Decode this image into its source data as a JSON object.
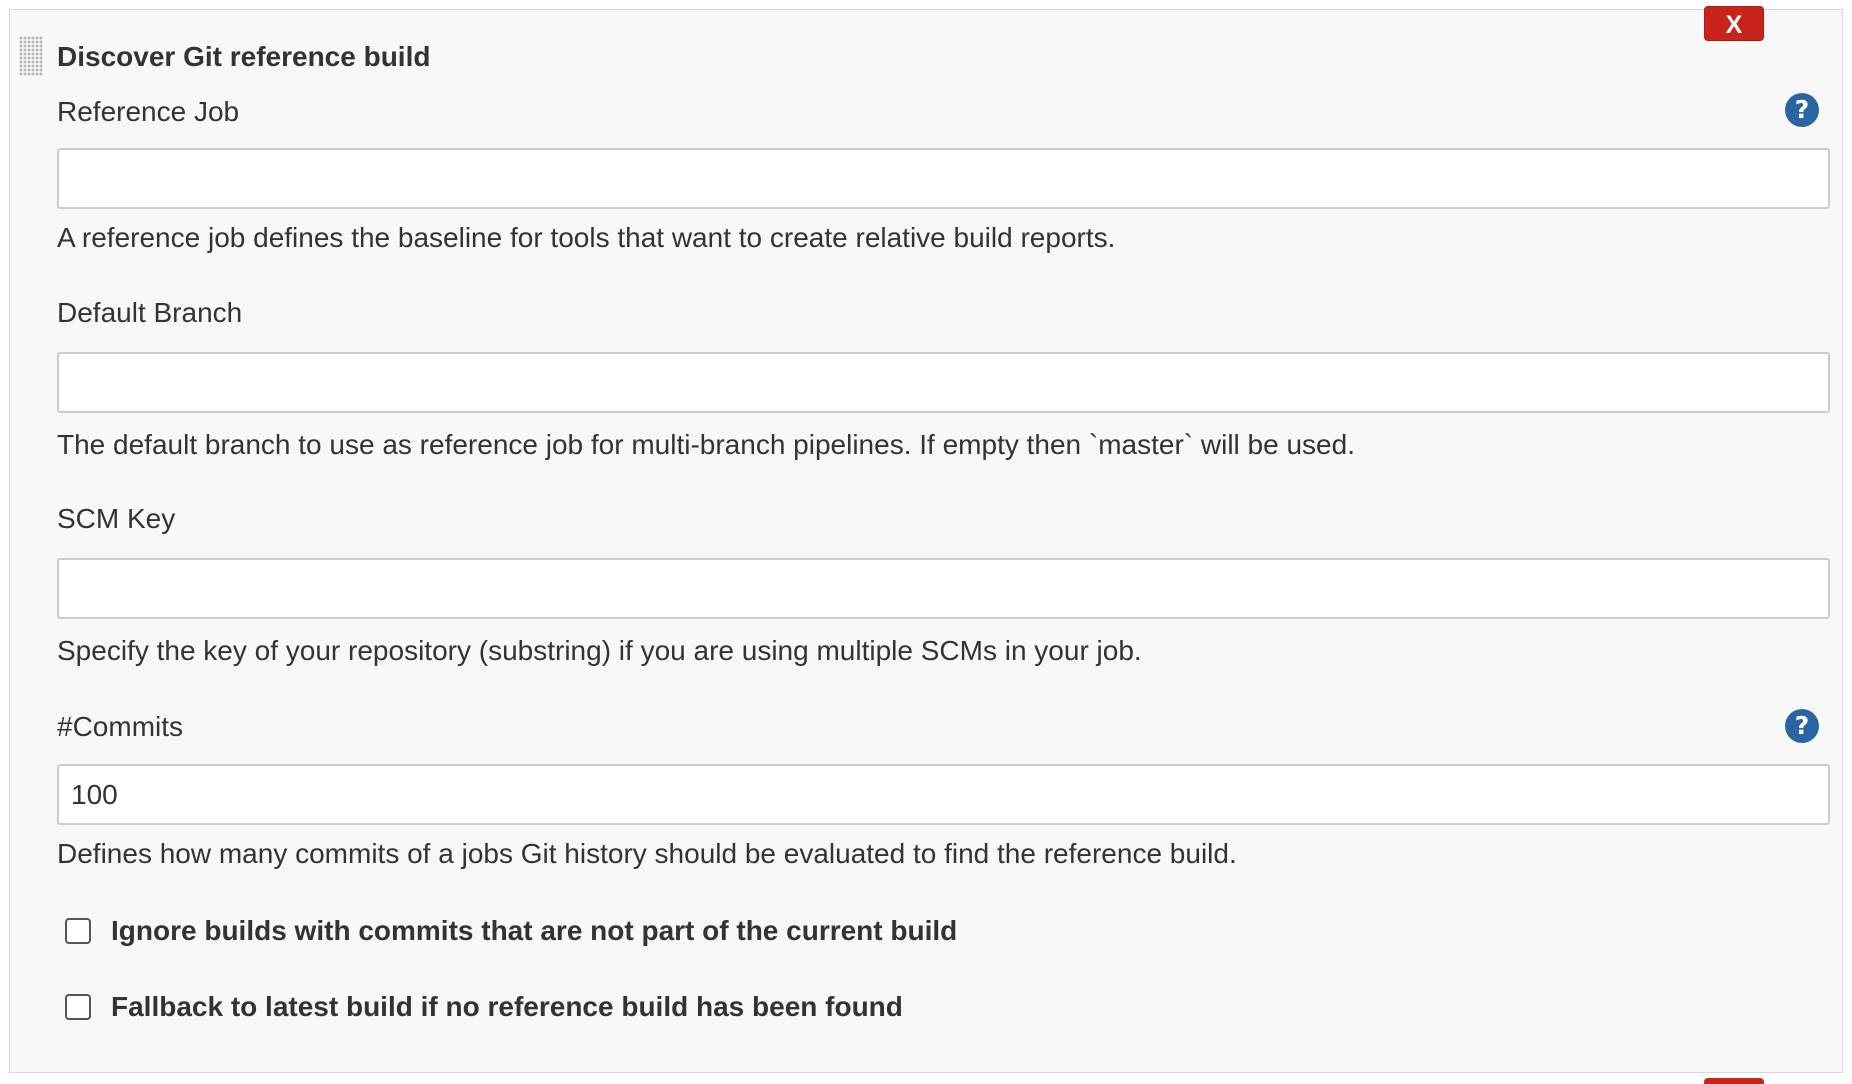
{
  "section": {
    "title": "Discover Git reference build",
    "close_label": "X"
  },
  "fields": {
    "reference_job": {
      "label": "Reference Job",
      "value": "",
      "description": "A reference job defines the baseline for tools that want to create relative build reports."
    },
    "default_branch": {
      "label": "Default Branch",
      "value": "",
      "description": "The default branch to use as reference job for multi-branch pipelines. If empty then `master` will be used."
    },
    "scm_key": {
      "label": "SCM Key",
      "value": "",
      "description": "Specify the key of your repository (substring) if you are using multiple SCMs in your job."
    },
    "commits": {
      "label": "#Commits",
      "value": "100",
      "description": "Defines how many commits of a jobs Git history should be evaluated to find the reference build."
    }
  },
  "help_icon_glyph": "?",
  "checkboxes": [
    {
      "label": "Ignore builds with commits that are not part of the current build",
      "checked": false
    },
    {
      "label": "Fallback to latest build if no reference build has been found",
      "checked": false
    }
  ],
  "colors": {
    "close_button": "#c9241b",
    "help_icon": "#2b64a3",
    "panel_background": "#f8f8f8"
  }
}
